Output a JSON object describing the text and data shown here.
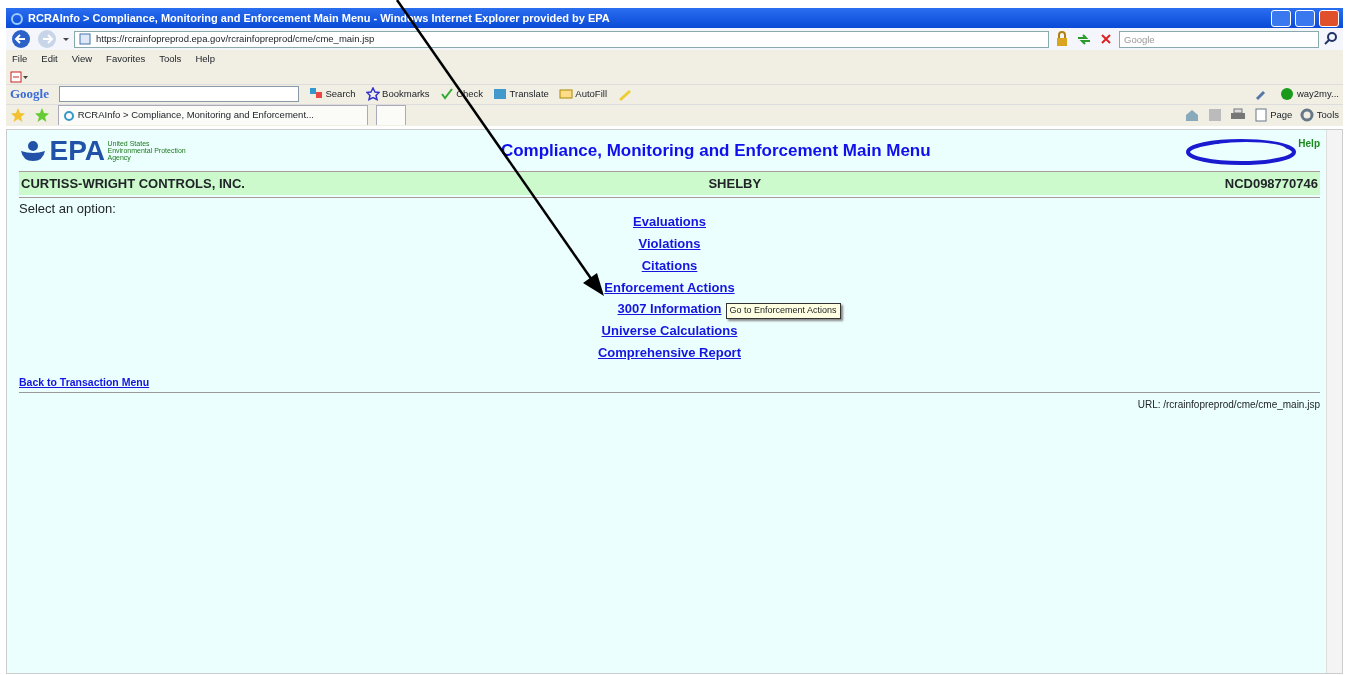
{
  "window": {
    "title": "RCRAInfo > Compliance, Monitoring and Enforcement Main Menu - Windows Internet Explorer provided by EPA"
  },
  "address": {
    "url": "https://rcrainfopreprod.epa.gov/rcrainfopreprod/cme/cme_main.jsp",
    "search_placeholder": "Google"
  },
  "menu": [
    "File",
    "Edit",
    "View",
    "Favorites",
    "Tools",
    "Help"
  ],
  "google_toolbar": {
    "logo": "Google",
    "items": [
      {
        "kind": "search",
        "label": "Search"
      },
      {
        "kind": "bookmarks",
        "label": "Bookmarks"
      },
      {
        "kind": "check",
        "label": "Check"
      },
      {
        "kind": "translate",
        "label": "Translate"
      },
      {
        "kind": "autofill",
        "label": "AutoFill"
      }
    ],
    "account": "way2my..."
  },
  "tab": {
    "label": "RCRAInfo > Compliance, Monitoring and Enforcement..."
  },
  "command_bar": [
    {
      "kind": "page",
      "label": "Page"
    },
    {
      "kind": "tools",
      "label": "Tools"
    }
  ],
  "page": {
    "agency": [
      "United States",
      "Environmental Protection",
      "Agency"
    ],
    "logo": "EPA",
    "heading": "Compliance, Monitoring and Enforcement Main Menu",
    "help": "Help",
    "facility": {
      "name": "CURTISS-WRIGHT CONTROLS, INC.",
      "city": "SHELBY",
      "id": "NCD098770746"
    },
    "prompt": "Select an option:",
    "links": [
      "Evaluations",
      "Violations",
      "Citations",
      "Enforcement Actions",
      "3007 Information",
      "Universe Calculations",
      "Comprehensive Report"
    ],
    "tooltip": "Go to Enforcement Actions",
    "back_link": "Back to Transaction Menu",
    "footer_url": "URL: /rcrainfopreprod/cme/cme_main.jsp"
  }
}
